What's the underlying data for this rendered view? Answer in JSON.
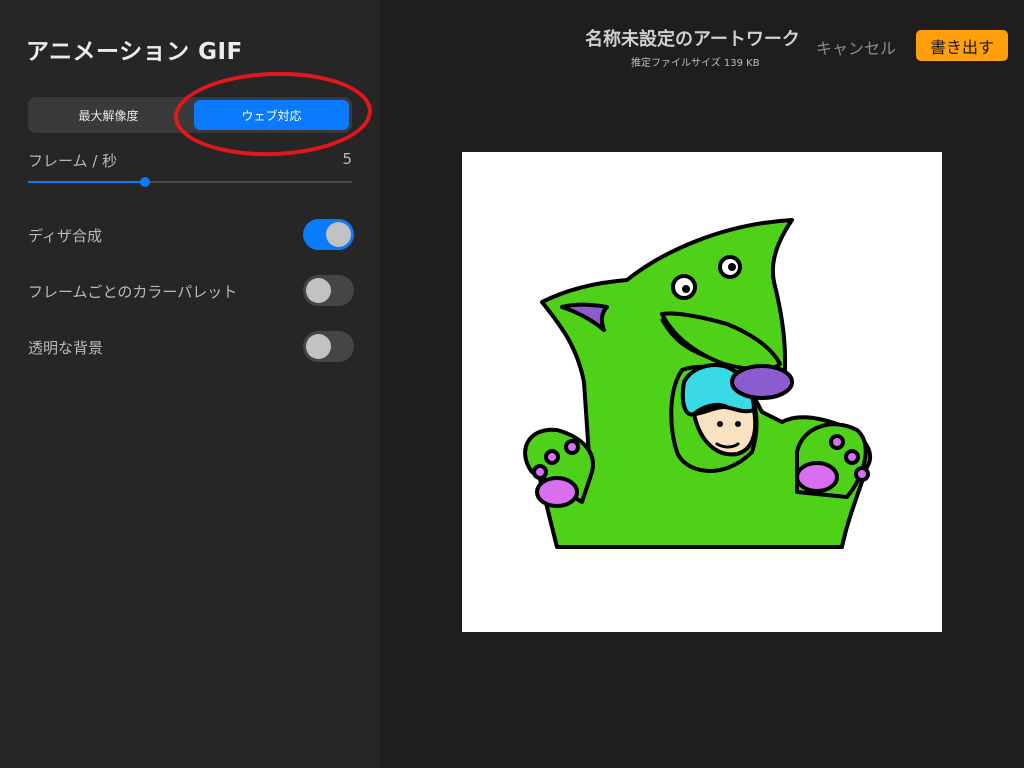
{
  "sidebar": {
    "title": "アニメーション GIF",
    "segments": [
      {
        "label": "最大解像度",
        "selected": false
      },
      {
        "label": "ウェブ対応",
        "selected": true
      }
    ],
    "fps": {
      "label": "フレーム / 秒",
      "value": "5",
      "level": 0.36
    },
    "toggles": [
      {
        "label": "ディザ合成",
        "on": true
      },
      {
        "label": "フレームごとのカラーパレット",
        "on": false
      },
      {
        "label": "透明な背景",
        "on": false
      }
    ]
  },
  "header": {
    "title": "名称未設定のアートワーク",
    "subtitle": "推定ファイルサイズ 139 KB",
    "cancel_label": "キャンセル",
    "export_label": "書き出す"
  },
  "colors": {
    "accent": "#0a7aff",
    "export": "#ff9f0a",
    "annotation": "#e3171b",
    "creature": "#4fd11a",
    "paw_pad": "#d86ef0",
    "ear_nose": "#8a5cd0",
    "hair": "#3ad9e6"
  },
  "icons": [
    "annotation-ellipse",
    "artwork-preview"
  ]
}
